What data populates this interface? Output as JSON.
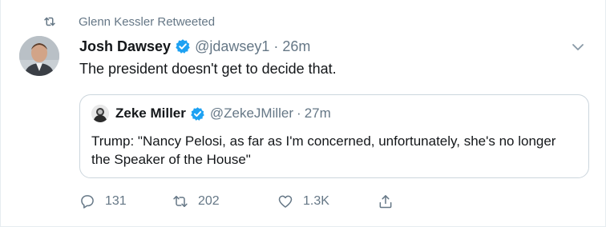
{
  "retweet_banner": {
    "text": "Glenn Kessler Retweeted",
    "icon": "retweet-icon"
  },
  "tweet": {
    "author_name": "Josh Dawsey",
    "author_handle": "@jdawsey1",
    "separator": "·",
    "time": "26m",
    "text": "The president doesn't get to decide that.",
    "menu_icon": "chevron-down-icon"
  },
  "quoted_tweet": {
    "author_name": "Zeke Miller",
    "author_handle": "@ZekeJMiller",
    "separator": "·",
    "time": "27m",
    "text": "Trump: \"Nancy Pelosi, as far as I'm concerned, unfortunately, she's no longer the Speaker of the House\""
  },
  "actions": {
    "reply_count": "131",
    "retweet_count": "202",
    "like_count": "1.3K"
  },
  "colors": {
    "verified": "#1da1f2",
    "secondary_text": "#657786",
    "border": "#ccd6dd"
  }
}
